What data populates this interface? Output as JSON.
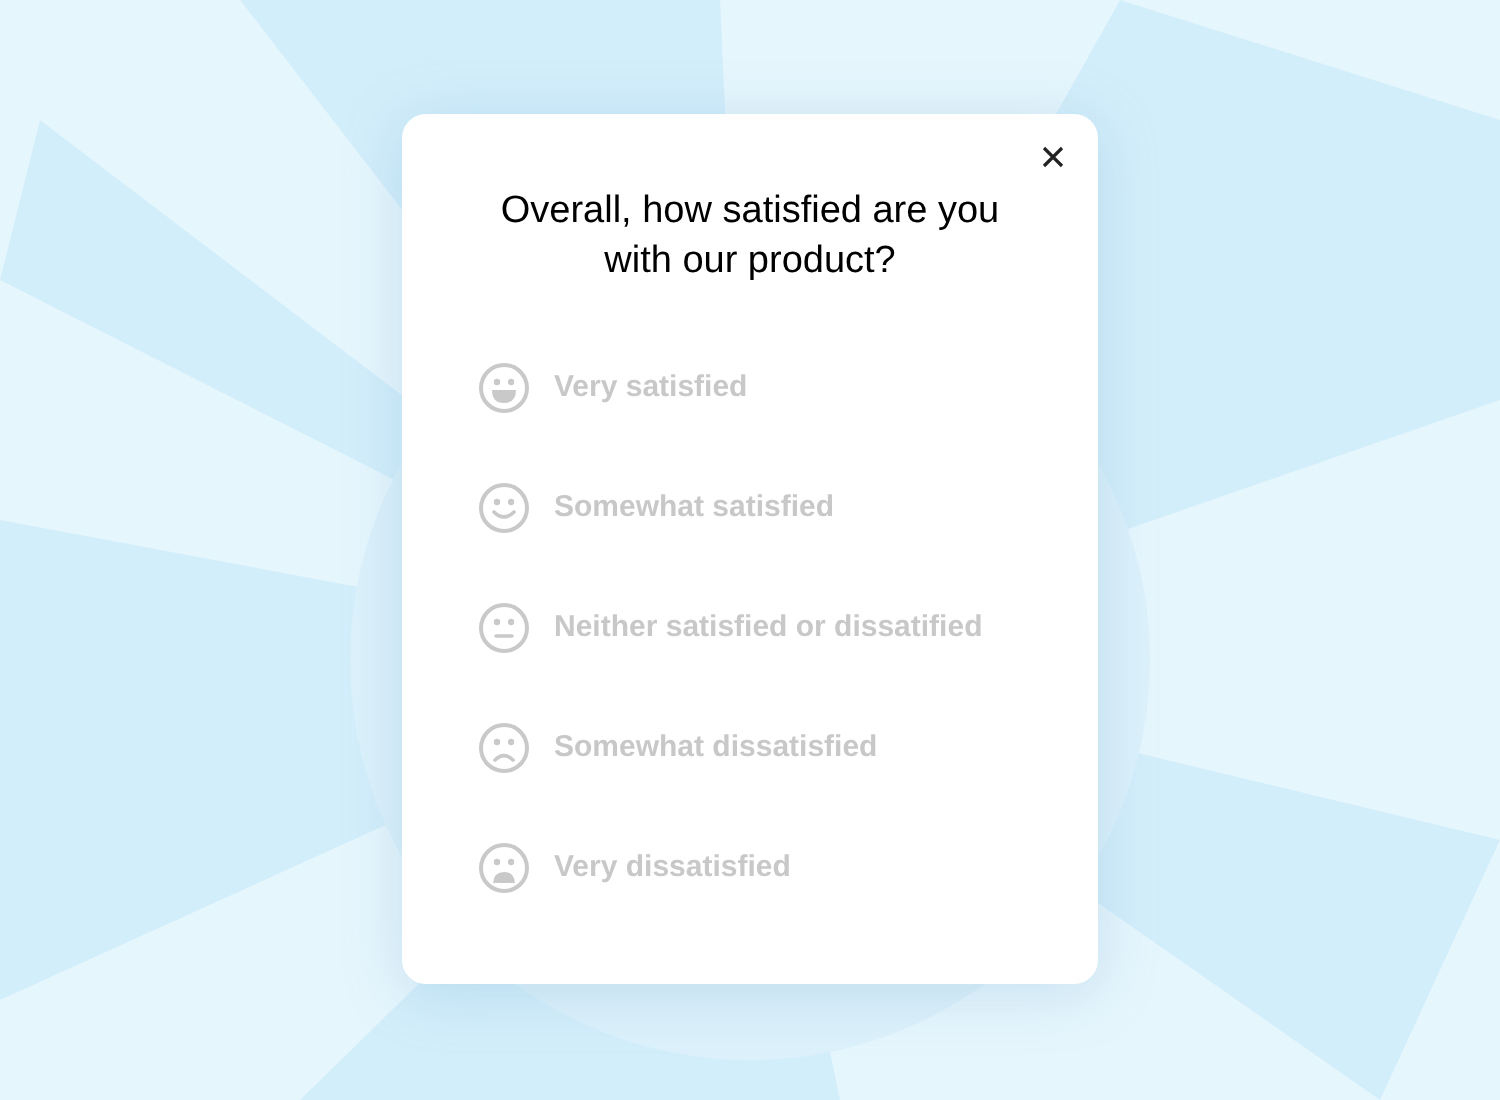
{
  "dialog": {
    "title": "Overall, how satisfied are you with our product?",
    "options": [
      {
        "kind": "very_happy",
        "label": "Very satisfied"
      },
      {
        "kind": "happy",
        "label": "Somewhat satisfied"
      },
      {
        "kind": "neutral",
        "label": "Neither satisfied or dissatified"
      },
      {
        "kind": "sad",
        "label": "Somewhat dissatisfied"
      },
      {
        "kind": "very_sad",
        "label": "Very dissatisfied"
      }
    ]
  }
}
